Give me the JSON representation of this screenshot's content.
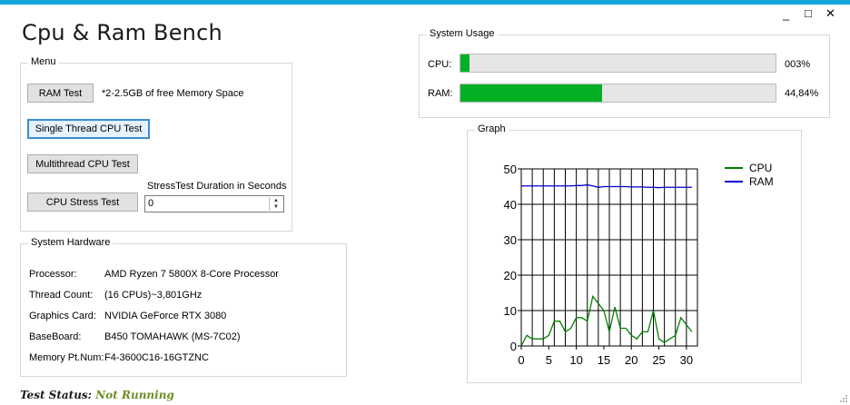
{
  "window": {
    "title": "Cpu & Ram Bench",
    "min": "_",
    "max": "□",
    "close": "✕"
  },
  "menu": {
    "label": "Menu",
    "ram_test": "RAM Test",
    "ram_note": "*2-2.5GB of free Memory Space",
    "single_thread": "Single Thread CPU Test",
    "multithread": "Multithread CPU Test",
    "stress_test": "CPU Stress Test",
    "duration_label": "StressTest Duration in Seconds",
    "duration_value": "0"
  },
  "hardware": {
    "label": "System Hardware",
    "rows": [
      {
        "key": "Processor:",
        "value": "AMD Ryzen 7 5800X 8-Core Processor"
      },
      {
        "key": "Thread Count:",
        "value": "(16 CPUs)~3,801GHz"
      },
      {
        "key": "Graphics Card:",
        "value": "NVIDIA GeForce RTX 3080"
      },
      {
        "key": "BaseBoard:",
        "value": "B450 TOMAHAWK (MS-7C02)"
      },
      {
        "key": "Memory Pt.Num:",
        "value": "F4-3600C16-16GTZNC"
      }
    ]
  },
  "usage": {
    "label": "System Usage",
    "cpu_label": "CPU:",
    "cpu_value": "003%",
    "cpu_fraction": 0.03,
    "ram_label": "RAM:",
    "ram_value": "44,84%",
    "ram_fraction": 0.4484,
    "bar_color": "#06b025"
  },
  "graph": {
    "label": "Graph"
  },
  "status": {
    "prefix": "Test Status:",
    "value": "Not Running",
    "prefix_color": "#1a1a1a",
    "value_color": "#6b8e23"
  },
  "chart_data": {
    "type": "line",
    "xlim": [
      0,
      32
    ],
    "ylim": [
      0,
      50
    ],
    "xticks": [
      0,
      5,
      10,
      15,
      20,
      25,
      30
    ],
    "yticks": [
      0,
      10,
      20,
      30,
      40,
      50
    ],
    "grid": true,
    "legend_position": "top-right",
    "series": [
      {
        "name": "CPU",
        "color": "#008000",
        "x": [
          0,
          1,
          2,
          3,
          4,
          5,
          6,
          7,
          8,
          9,
          10,
          11,
          12,
          13,
          14,
          15,
          16,
          17,
          18,
          19,
          20,
          21,
          22,
          23,
          24,
          25,
          26,
          27,
          28,
          29,
          30,
          31
        ],
        "y": [
          0,
          3,
          2,
          2,
          2,
          3,
          7,
          7,
          4,
          5,
          8,
          8,
          7,
          14,
          12,
          10,
          4,
          11,
          5,
          5,
          3,
          2,
          4,
          4,
          10,
          2,
          1,
          2,
          3,
          8,
          6,
          4
        ]
      },
      {
        "name": "RAM",
        "color": "#0000cd",
        "x": [
          0,
          1,
          2,
          3,
          4,
          5,
          6,
          7,
          8,
          9,
          10,
          11,
          12,
          13,
          14,
          15,
          16,
          17,
          18,
          19,
          20,
          21,
          22,
          23,
          24,
          25,
          26,
          27,
          28,
          29,
          30,
          31
        ],
        "y": [
          45.2,
          45.2,
          45.2,
          45.2,
          45.2,
          45.2,
          45.2,
          45.2,
          45.2,
          45.2,
          45.3,
          45.3,
          45.5,
          45.2,
          44.8,
          45,
          45,
          45,
          45,
          45,
          44.9,
          44.9,
          44.9,
          44.8,
          44.8,
          44.7,
          44.8,
          44.8,
          44.8,
          44.8,
          44.8,
          44.8
        ]
      }
    ]
  }
}
